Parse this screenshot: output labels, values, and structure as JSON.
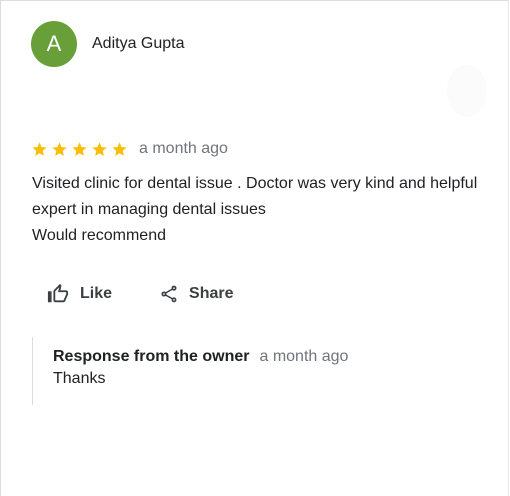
{
  "reviewer": {
    "initial": "A",
    "name": "Aditya Gupta",
    "avatar_color": "#689f38"
  },
  "review": {
    "rating": 5,
    "max_rating": 5,
    "star_color": "#fbbc04",
    "date": "a month ago",
    "text": "Visited clinic for dental issue . Doctor was very kind and helpful   expert in managing dental issues\nWould recommend"
  },
  "actions": {
    "like_label": "Like",
    "share_label": "Share",
    "like_icon": "thumbs-up-icon",
    "share_icon": "share-icon"
  },
  "owner_response": {
    "title": "Response from the owner",
    "date": "a month ago",
    "text": "Thanks"
  }
}
